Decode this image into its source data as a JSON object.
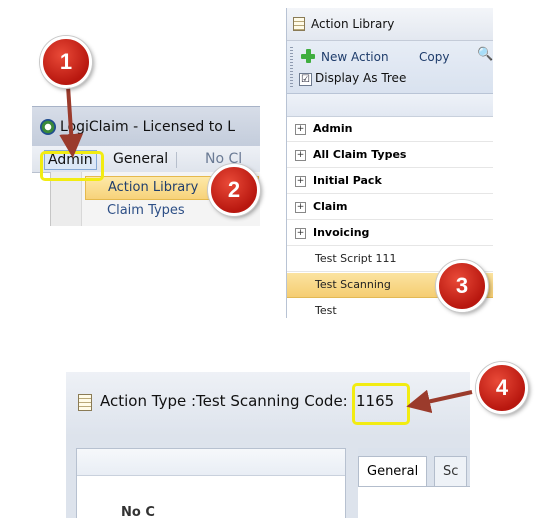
{
  "main_window": {
    "title": "LogiClaim - Licensed to L",
    "menu": {
      "admin": "Admin",
      "general": "General",
      "more": "No Cl"
    },
    "admin_menu": {
      "action_library": "Action Library",
      "claim_types": "Claim Types"
    }
  },
  "action_library": {
    "title": "Action Library",
    "toolbar": {
      "new_action": "New Action",
      "copy": "Copy",
      "display_as_tree": "Display As Tree",
      "display_as_tree_checked": "☑"
    },
    "tree": [
      {
        "label": "Admin",
        "expander": "+"
      },
      {
        "label": "All Claim Types",
        "expander": "+"
      },
      {
        "label": "Initial Pack",
        "expander": "+"
      },
      {
        "label": "Claim",
        "expander": "+"
      },
      {
        "label": "Invoicing",
        "expander": "+"
      }
    ],
    "items": [
      {
        "label": "Test Script 111"
      },
      {
        "label": "Test Scanning",
        "selected": true
      },
      {
        "label": "Test"
      }
    ]
  },
  "action_type": {
    "title": "Action Type :Test Scanning Code:",
    "code": "1165",
    "tabs": {
      "general": "General",
      "second": "Sc"
    },
    "list_partial_text": "No C"
  },
  "callouts": {
    "one": "1",
    "two": "2",
    "three": "3",
    "four": "4"
  },
  "colors": {
    "callout_red": "#d32a1c",
    "highlight_yellow": "#f2ec12",
    "arrow_brown": "#9b3b2c",
    "selected_row": "#f7d27a"
  }
}
